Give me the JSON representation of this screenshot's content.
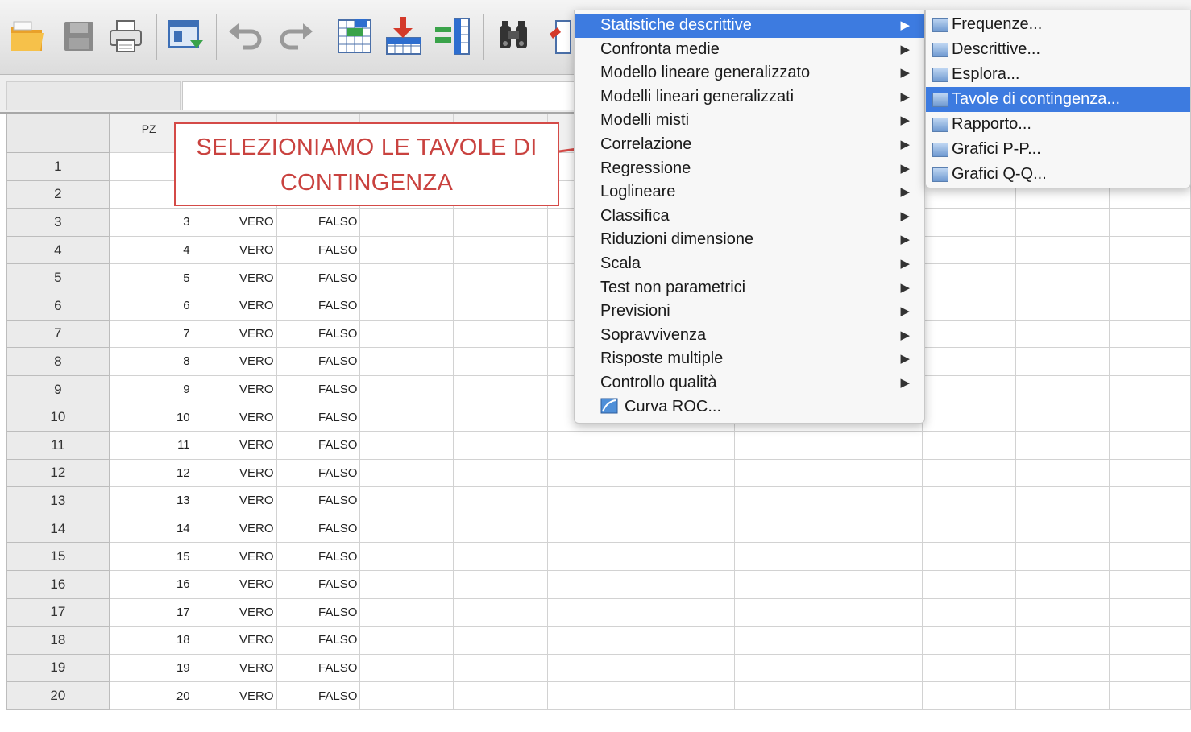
{
  "toolbar": {
    "icons": [
      "open-folder-icon",
      "save-icon",
      "print-icon",
      "dialog-recall-icon",
      "undo-icon",
      "redo-icon",
      "goto-case-icon",
      "goto-variable-icon",
      "variables-icon",
      "find-icon",
      "insert-cases-icon"
    ]
  },
  "grid": {
    "column_header": "PZ",
    "rows": [
      {
        "n": "1",
        "pz": "",
        "a": "",
        "b": ""
      },
      {
        "n": "2",
        "pz": "",
        "a": "",
        "b": ""
      },
      {
        "n": "3",
        "pz": "3",
        "a": "VERO",
        "b": "FALSO"
      },
      {
        "n": "4",
        "pz": "4",
        "a": "VERO",
        "b": "FALSO"
      },
      {
        "n": "5",
        "pz": "5",
        "a": "VERO",
        "b": "FALSO"
      },
      {
        "n": "6",
        "pz": "6",
        "a": "VERO",
        "b": "FALSO"
      },
      {
        "n": "7",
        "pz": "7",
        "a": "VERO",
        "b": "FALSO"
      },
      {
        "n": "8",
        "pz": "8",
        "a": "VERO",
        "b": "FALSO"
      },
      {
        "n": "9",
        "pz": "9",
        "a": "VERO",
        "b": "FALSO"
      },
      {
        "n": "10",
        "pz": "10",
        "a": "VERO",
        "b": "FALSO"
      },
      {
        "n": "11",
        "pz": "11",
        "a": "VERO",
        "b": "FALSO"
      },
      {
        "n": "12",
        "pz": "12",
        "a": "VERO",
        "b": "FALSO"
      },
      {
        "n": "13",
        "pz": "13",
        "a": "VERO",
        "b": "FALSO"
      },
      {
        "n": "14",
        "pz": "14",
        "a": "VERO",
        "b": "FALSO"
      },
      {
        "n": "15",
        "pz": "15",
        "a": "VERO",
        "b": "FALSO"
      },
      {
        "n": "16",
        "pz": "16",
        "a": "VERO",
        "b": "FALSO"
      },
      {
        "n": "17",
        "pz": "17",
        "a": "VERO",
        "b": "FALSO"
      },
      {
        "n": "18",
        "pz": "18",
        "a": "VERO",
        "b": "FALSO"
      },
      {
        "n": "19",
        "pz": "19",
        "a": "VERO",
        "b": "FALSO"
      },
      {
        "n": "20",
        "pz": "20",
        "a": "VERO",
        "b": "FALSO"
      }
    ]
  },
  "callout": {
    "line1": "SELEZIONIAMO LE TAVOLE DI",
    "line2": "CONTINGENZA",
    "color": "#c9423f"
  },
  "menu": {
    "items": [
      {
        "label": "Statistiche descrittive",
        "submenu": true,
        "selected": true
      },
      {
        "label": "Confronta medie",
        "submenu": true
      },
      {
        "label": "Modello lineare generalizzato",
        "submenu": true
      },
      {
        "label": "Modelli lineari generalizzati",
        "submenu": true
      },
      {
        "label": "Modelli misti",
        "submenu": true
      },
      {
        "label": "Correlazione",
        "submenu": true
      },
      {
        "label": "Regressione",
        "submenu": true
      },
      {
        "label": "Loglineare",
        "submenu": true
      },
      {
        "label": "Classifica",
        "submenu": true
      },
      {
        "label": "Riduzioni dimensione",
        "submenu": true
      },
      {
        "label": "Scala",
        "submenu": true
      },
      {
        "label": "Test non parametrici",
        "submenu": true
      },
      {
        "label": "Previsioni",
        "submenu": true
      },
      {
        "label": "Sopravvivenza",
        "submenu": true
      },
      {
        "label": "Risposte multiple",
        "submenu": true
      },
      {
        "label": "Controllo qualità",
        "submenu": true
      },
      {
        "label": "Curva ROC...",
        "submenu": false,
        "icon": "roc-curve-icon"
      }
    ]
  },
  "submenu": {
    "items": [
      {
        "label": "Frequenze...",
        "icon": "frequencies-icon"
      },
      {
        "label": "Descrittive...",
        "icon": "descriptives-icon"
      },
      {
        "label": "Esplora...",
        "icon": "explore-icon"
      },
      {
        "label": "Tavole di contingenza...",
        "icon": "crosstabs-icon",
        "selected": true
      },
      {
        "label": "Rapporto...",
        "icon": "ratio-icon"
      },
      {
        "label": "Grafici P-P...",
        "icon": "pp-plot-icon"
      },
      {
        "label": "Grafici Q-Q...",
        "icon": "qq-plot-icon"
      }
    ]
  },
  "colors": {
    "selection": "#3d7be0",
    "annotation": "#d44a47"
  }
}
